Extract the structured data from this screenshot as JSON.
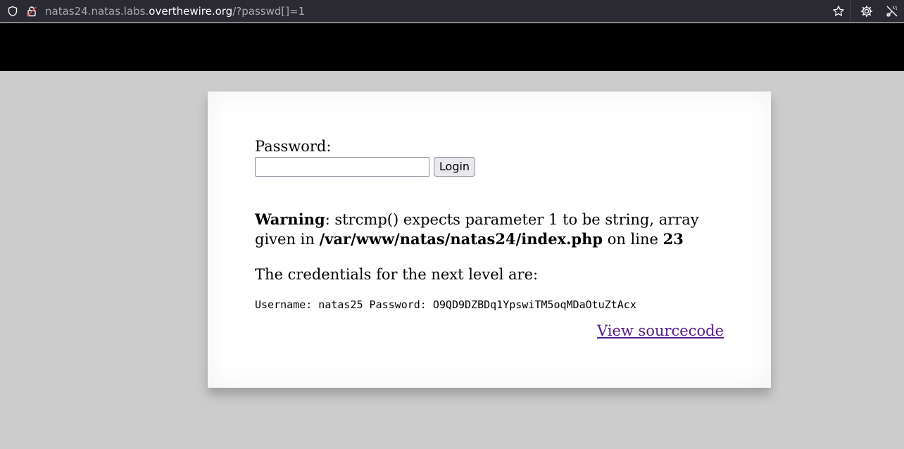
{
  "browser": {
    "url_prefix": "natas24.natas.labs.",
    "url_domain": "overthewire.org",
    "url_suffix": "/?passwd[]=1",
    "icons": [
      "shield-icon",
      "lock-warning-icon",
      "bookmark-star-icon",
      "gear-icon",
      "extension-icon"
    ]
  },
  "form": {
    "password_label": "Password:",
    "password_value": "",
    "login_label": "Login"
  },
  "warning": {
    "prefix": "Warning",
    "message": ": strcmp() expects parameter 1 to be string, array given in ",
    "file": "/var/www/natas/natas24/index.php",
    "on_line": " on line ",
    "line": "23"
  },
  "credentials": {
    "heading": "The credentials for the next level are:",
    "line": "Username: natas25 Password: O9QD9DZBDq1YpswiTM5oqMDaOtuZtAcx"
  },
  "links": {
    "view_source": "View sourcecode"
  },
  "colors": {
    "page_bg": "#cccccc",
    "header_band": "#000000",
    "link": "#551a8b"
  }
}
